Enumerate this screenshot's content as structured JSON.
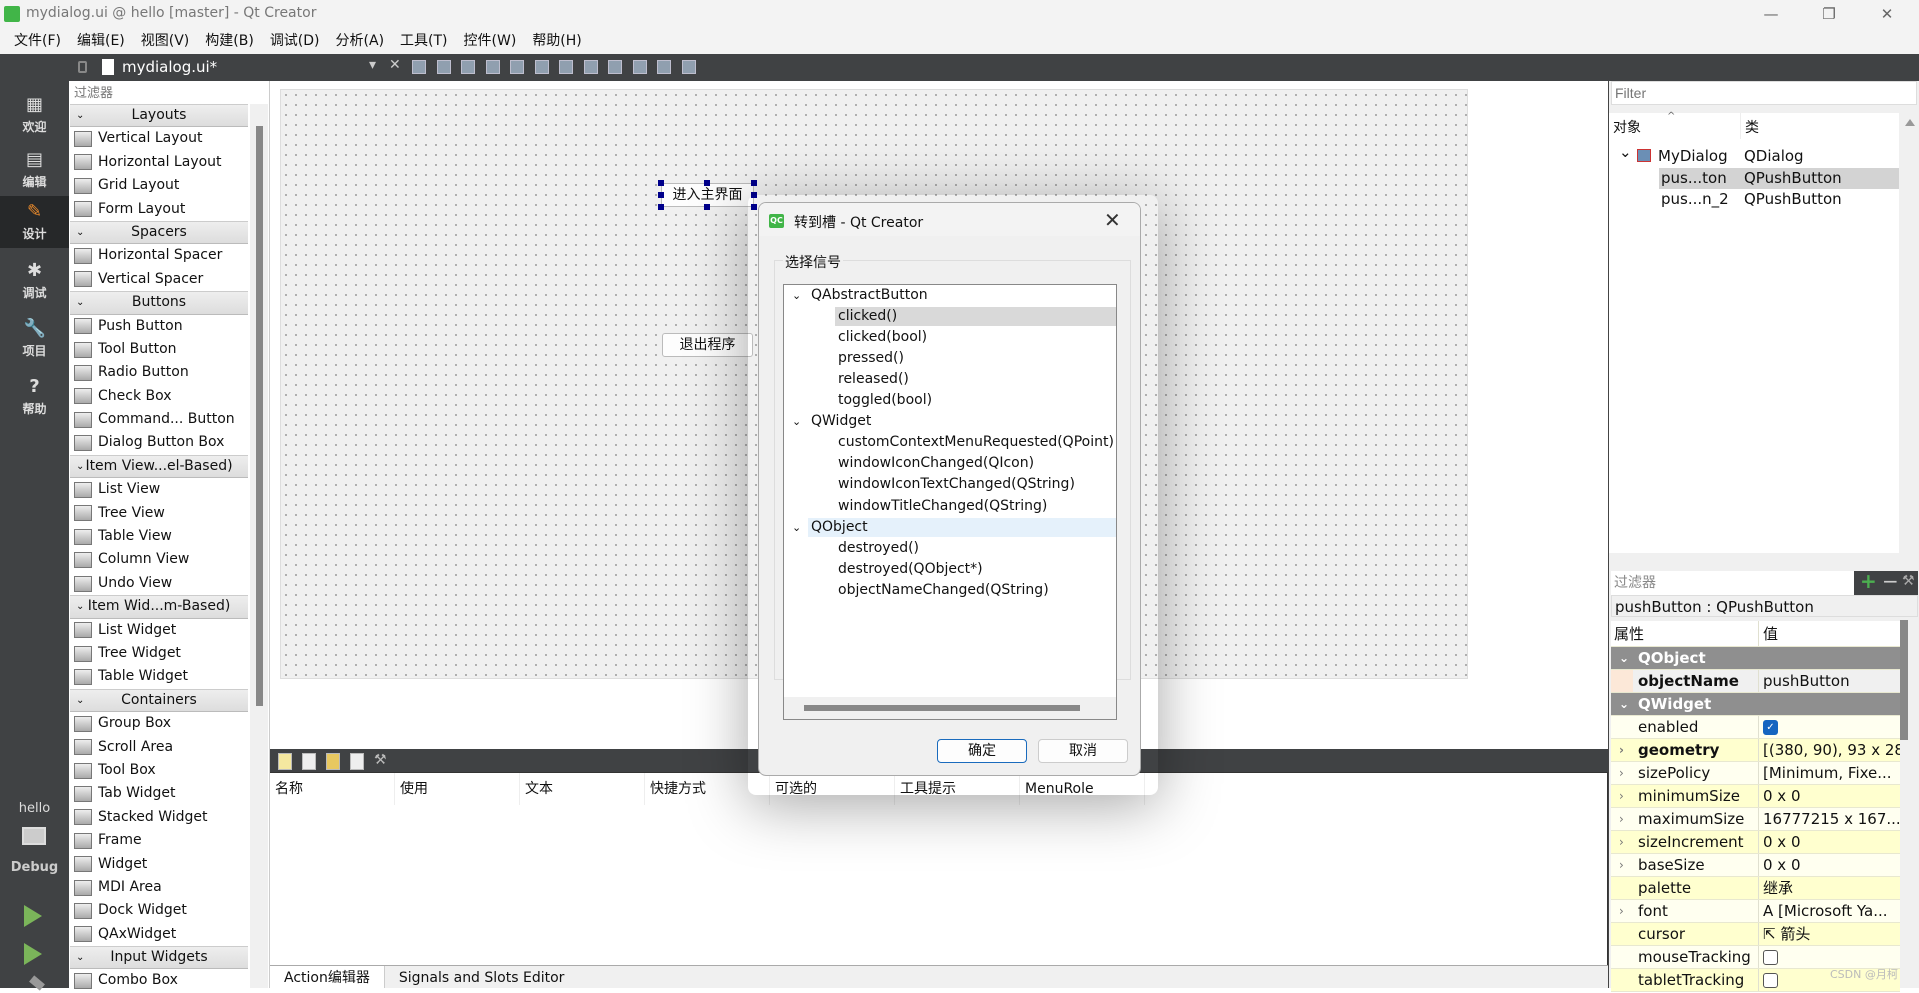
{
  "window": {
    "title": "mydialog.ui @ hello [master] - Qt Creator",
    "logo": "QC",
    "minimize": "—",
    "restore": "❐",
    "close": "✕"
  },
  "menu": [
    "文件(F)",
    "编辑(E)",
    "视图(V)",
    "构建(B)",
    "调试(D)",
    "分析(A)",
    "工具(T)",
    "控件(W)",
    "帮助(H)"
  ],
  "toolbar": {
    "file_name": "mydialog.ui*",
    "dropdown": "▾",
    "close": "✕"
  },
  "modes": [
    {
      "label": "欢迎",
      "icon": "grid-icon",
      "glyph": "▦"
    },
    {
      "label": "编辑",
      "icon": "document-icon",
      "glyph": "▤"
    },
    {
      "label": "设计",
      "icon": "pencil-icon",
      "glyph": "✎",
      "active": true
    },
    {
      "label": "调试",
      "icon": "bug-icon",
      "glyph": "✱"
    },
    {
      "label": "项目",
      "icon": "wrench-icon",
      "glyph": "🔧"
    },
    {
      "label": "帮助",
      "icon": "help-icon",
      "glyph": "?"
    }
  ],
  "kit": {
    "project": "hello",
    "build": "Debug"
  },
  "widgetbox": {
    "filter_placeholder": "过滤器",
    "rows": [
      {
        "h": "Layouts"
      },
      "Vertical Layout",
      "Horizontal Layout",
      "Grid Layout",
      "Form Layout",
      {
        "h": "Spacers"
      },
      "Horizontal Spacer",
      "Vertical Spacer",
      {
        "h": "Buttons"
      },
      "Push Button",
      "Tool Button",
      "Radio Button",
      "Check Box",
      "Command... Button",
      "Dialog Button Box",
      {
        "h": "Item View...el-Based)"
      },
      "List View",
      "Tree View",
      "Table View",
      "Column View",
      "Undo View",
      {
        "h": "Item Wid...m-Based)"
      },
      "List Widget",
      "Tree Widget",
      "Table Widget",
      {
        "h": "Containers"
      },
      "Group Box",
      "Scroll Area",
      "Tool Box",
      "Tab Widget",
      "Stacked Widget",
      "Frame",
      "Widget",
      "MDI Area",
      "Dock Widget",
      "QAxWidget",
      {
        "h": "Input Widgets"
      },
      "Combo Box"
    ]
  },
  "form": {
    "button1": "进入主界面",
    "button2": "退出程序"
  },
  "action_editor": {
    "columns": [
      "名称",
      "使用",
      "文本",
      "快捷方式",
      "可选的",
      "工具提示",
      "MenuRole"
    ],
    "tabs": [
      "Action编辑器",
      "Signals and Slots Editor"
    ]
  },
  "object_inspector": {
    "filter_placeholder": "Filter",
    "col_object": "对象",
    "col_class": "类",
    "rows": [
      {
        "name": "MyDialog",
        "class": "QDialog"
      },
      {
        "name": "pus...ton",
        "class": "QPushButton",
        "selected": true
      },
      {
        "name": "pus...n_2",
        "class": "QPushButton"
      }
    ]
  },
  "property_editor": {
    "filter_placeholder": "过滤器",
    "object_label": "pushButton : QPushButton",
    "col_property": "属性",
    "col_value": "值",
    "rows": [
      {
        "group": "QObject"
      },
      {
        "name": "objectName",
        "value": "pushButton",
        "bold": true
      },
      {
        "group": "QWidget"
      },
      {
        "name": "enabled",
        "checkbox": true,
        "checked": true
      },
      {
        "name": "geometry",
        "value": "[(380, 90), 93 x 28]",
        "bold": true,
        "expandable": true
      },
      {
        "name": "sizePolicy",
        "value": "[Minimum, Fixe...",
        "expandable": true
      },
      {
        "name": "minimumSize",
        "value": "0 x 0",
        "expandable": true
      },
      {
        "name": "maximumSize",
        "value": "16777215 x 167...",
        "expandable": true
      },
      {
        "name": "sizeIncrement",
        "value": "0 x 0",
        "expandable": true
      },
      {
        "name": "baseSize",
        "value": "0 x 0",
        "expandable": true
      },
      {
        "name": "palette",
        "value": "继承"
      },
      {
        "name": "font",
        "value": "A  [Microsoft Ya...",
        "expandable": true
      },
      {
        "name": "cursor",
        "value": "⇱  箭头"
      },
      {
        "name": "mouseTracking",
        "checkbox": true,
        "checked": false
      },
      {
        "name": "tabletTracking",
        "checkbox": true,
        "checked": false
      }
    ]
  },
  "dialog": {
    "title": "转到槽 - Qt Creator",
    "group_label": "选择信号",
    "tree": [
      {
        "group": "QAbstractButton"
      },
      {
        "signal": "clicked()",
        "selected": true
      },
      {
        "signal": "clicked(bool)"
      },
      {
        "signal": "pressed()"
      },
      {
        "signal": "released()"
      },
      {
        "signal": "toggled(bool)"
      },
      {
        "group": "QWidget"
      },
      {
        "signal": "customContextMenuRequested(QPoint)"
      },
      {
        "signal": "windowIconChanged(QIcon)"
      },
      {
        "signal": "windowIconTextChanged(QString)"
      },
      {
        "signal": "windowTitleChanged(QString)"
      },
      {
        "group": "QObject",
        "hover": true
      },
      {
        "signal": "destroyed()"
      },
      {
        "signal": "destroyed(QObject*)"
      },
      {
        "signal": "objectNameChanged(QString)"
      }
    ],
    "ok": "确定",
    "cancel": "取消"
  },
  "watermark": "CSDN @月柯",
  "colors": {
    "dark_bar": "#404244",
    "accent": "#1a6bbd",
    "qt_green": "#41b548",
    "selection": "#d9d9d9"
  }
}
